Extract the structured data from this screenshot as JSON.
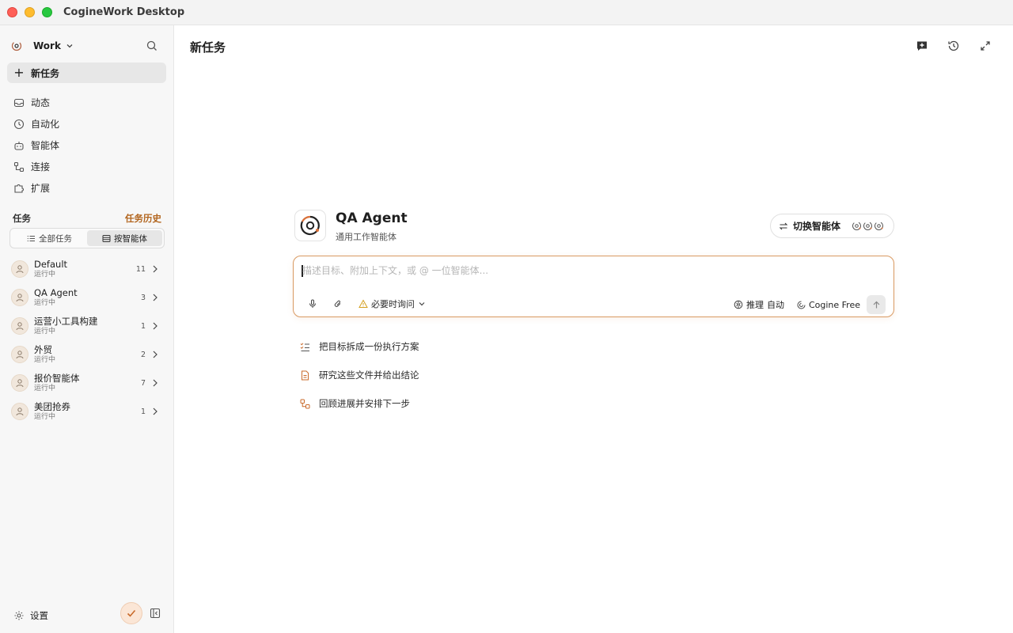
{
  "window": {
    "title": "CogineWork Desktop"
  },
  "sidebar": {
    "workspace": "Work",
    "new_task": "新任务",
    "nav": [
      {
        "label": "动态",
        "icon": "inbox-icon"
      },
      {
        "label": "自动化",
        "icon": "clock-icon"
      },
      {
        "label": "智能体",
        "icon": "robot-icon"
      },
      {
        "label": "连接",
        "icon": "connection-icon"
      },
      {
        "label": "扩展",
        "icon": "puzzle-icon"
      }
    ],
    "tasks_title": "任务",
    "tasks_history": "任务历史",
    "segments": {
      "all": "全部任务",
      "by_agent": "按智能体"
    },
    "agents": [
      {
        "name": "Default",
        "status": "运行中",
        "count": "11"
      },
      {
        "name": "QA Agent",
        "status": "运行中",
        "count": "3"
      },
      {
        "name": "运营小工具构建",
        "status": "运行中",
        "count": "1"
      },
      {
        "name": "外贸",
        "status": "运行中",
        "count": "2"
      },
      {
        "name": "报价智能体",
        "status": "运行中",
        "count": "7"
      },
      {
        "name": "美团抢券",
        "status": "运行中",
        "count": "1"
      }
    ],
    "settings": "设置"
  },
  "main": {
    "title": "新任务",
    "agent": {
      "name": "QA Agent",
      "subtitle": "通用工作智能体"
    },
    "switch_label": "切换智能体",
    "composer": {
      "placeholder": "描述目标、附加上下文，或 @ 一位智能体...",
      "ask_label": "必要时询问",
      "reason_label": "推理",
      "reason_value": "自动",
      "model": "Cogine Free"
    },
    "suggestions": [
      {
        "label": "把目标拆成一份执行方案",
        "icon": "checklist-icon"
      },
      {
        "label": "研究这些文件并给出结论",
        "icon": "document-icon"
      },
      {
        "label": "回顾进展并安排下一步",
        "icon": "flow-icon"
      }
    ]
  },
  "colors": {
    "accent": "#d97a3a",
    "history_link": "#b2651e",
    "composer_border": "#d99a62"
  }
}
